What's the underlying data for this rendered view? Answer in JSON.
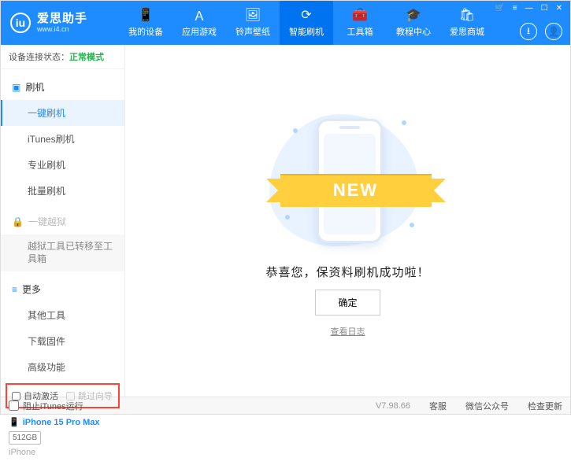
{
  "header": {
    "logo_text": "iu",
    "app_name": "爱思助手",
    "app_site": "www.i4.cn",
    "nav": [
      {
        "label": "我的设备",
        "icon": "📱"
      },
      {
        "label": "应用游戏",
        "icon": "Ａ"
      },
      {
        "label": "铃声壁纸",
        "icon": "🖼"
      },
      {
        "label": "智能刷机",
        "icon": "⟳"
      },
      {
        "label": "工具箱",
        "icon": "🧰"
      },
      {
        "label": "教程中心",
        "icon": "🎓"
      },
      {
        "label": "爱思商城",
        "icon": "🛍"
      }
    ],
    "cart_icon": "🛒",
    "menu_icon": "≡",
    "min_icon": "—",
    "max_icon": "☐",
    "close_icon": "✕",
    "download_icon": "⭳",
    "user_icon": "👤"
  },
  "sidebar": {
    "status_label": "设备连接状态：",
    "status_value": "正常模式",
    "sections": {
      "flash": {
        "title": "刷机",
        "items": [
          "一键刷机",
          "iTunes刷机",
          "专业刷机",
          "批量刷机"
        ]
      },
      "jailbreak": {
        "title": "一键越狱",
        "note": "越狱工具已转移至工具箱"
      },
      "more": {
        "title": "更多",
        "items": [
          "其他工具",
          "下载固件",
          "高级功能"
        ]
      }
    },
    "checkbox1": "自动激活",
    "checkbox2": "跳过向导",
    "device": {
      "name": "iPhone 15 Pro Max",
      "capacity": "512GB",
      "model": "iPhone"
    }
  },
  "main": {
    "ribbon": "NEW",
    "message": "恭喜您，保资料刷机成功啦！",
    "ok_label": "确定",
    "log_label": "查看日志"
  },
  "footer": {
    "block_itunes": "阻止iTunes运行",
    "version": "V7.98.66",
    "links": [
      "客服",
      "微信公众号",
      "检查更新"
    ]
  }
}
